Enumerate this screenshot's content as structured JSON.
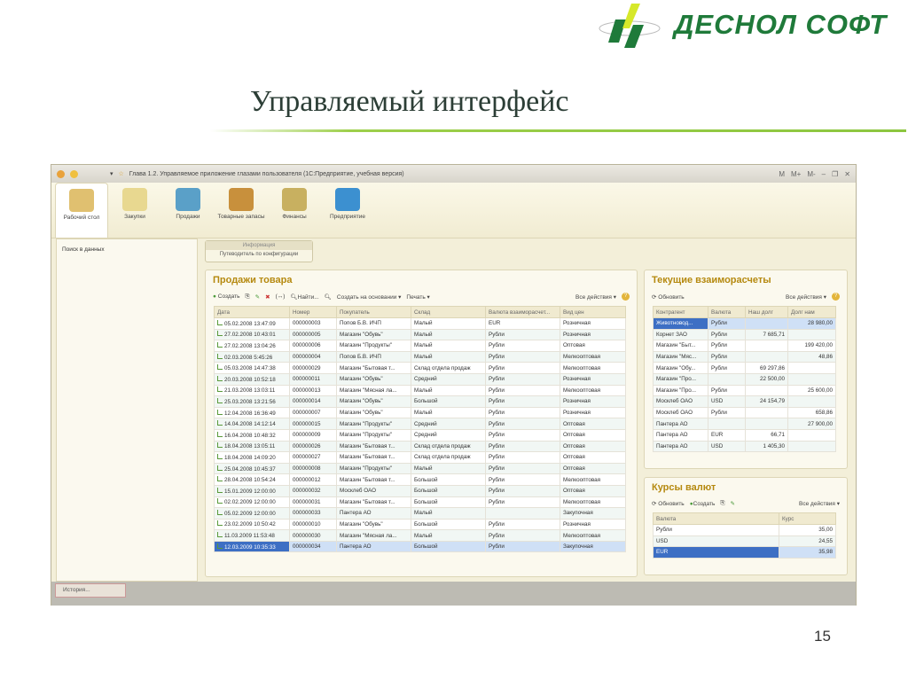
{
  "slide": {
    "logo_text": "ДЕСНОЛ СОФТ",
    "title": "Управляемый интерфейс",
    "page_number": "15"
  },
  "app": {
    "window_title": "Глава 1.2. Управляемое приложение глазами пользователя  (1С:Предприятие, учебная версия)",
    "titlebar_buttons": [
      "M",
      "M+",
      "M-"
    ],
    "sections": [
      "Рабочий стол",
      "Закупки",
      "Продажи",
      "Товарные запасы",
      "Финансы",
      "Предприятие"
    ],
    "left_panel": {
      "search": "Поиск в данных"
    },
    "info": {
      "header": "Информация",
      "link": "Путеводитель по конфигурации"
    },
    "history_tab": "История..."
  },
  "sales": {
    "title": "Продажи товара",
    "toolbar": {
      "create": "Создать",
      "find": "Найти...",
      "create_based": "Создать на основании ▾",
      "print": "Печать ▾",
      "all_actions": "Все действия ▾"
    },
    "columns": [
      "Дата",
      "Номер",
      "Покупатель",
      "Склад",
      "Валюта взаиморасчет...",
      "Вид цен"
    ],
    "rows": [
      [
        "05.02.2008 13:47:09",
        "000000003",
        "Попов Б.В. ИЧП",
        "Малый",
        "EUR",
        "Розничная"
      ],
      [
        "27.02.2008 10:43:01",
        "000000005",
        "Магазин \"Обувь\"",
        "Малый",
        "Рубли",
        "Розничная"
      ],
      [
        "27.02.2008 13:04:26",
        "000000006",
        "Магазин \"Продукты\"",
        "Малый",
        "Рубли",
        "Оптовая"
      ],
      [
        "02.03.2008 5:45:26",
        "000000004",
        "Попов Б.В. ИЧП",
        "Малый",
        "Рубли",
        "Мелкооптовая"
      ],
      [
        "05.03.2008 14:47:38",
        "000000029",
        "Магазин \"Бытовая т...",
        "Склад отдела продаж",
        "Рубли",
        "Мелкооптовая"
      ],
      [
        "20.03.2008 10:52:18",
        "000000011",
        "Магазин \"Обувь\"",
        "Средний",
        "Рубли",
        "Розничная"
      ],
      [
        "21.03.2008 13:03:11",
        "000000013",
        "Магазин \"Мясная ла...",
        "Малый",
        "Рубли",
        "Мелкооптовая"
      ],
      [
        "25.03.2008 13:21:56",
        "000000014",
        "Магазин \"Обувь\"",
        "Большой",
        "Рубли",
        "Розничная"
      ],
      [
        "12.04.2008 16:36:49",
        "000000007",
        "Магазин \"Обувь\"",
        "Малый",
        "Рубли",
        "Розничная"
      ],
      [
        "14.04.2008 14:12:14",
        "000000015",
        "Магазин \"Продукты\"",
        "Средний",
        "Рубли",
        "Оптовая"
      ],
      [
        "16.04.2008 10:48:32",
        "000000009",
        "Магазин \"Продукты\"",
        "Средний",
        "Рубли",
        "Оптовая"
      ],
      [
        "18.04.2008 13:05:11",
        "000000026",
        "Магазин \"Бытовая т...",
        "Склад отдела продаж",
        "Рубли",
        "Оптовая"
      ],
      [
        "18.04.2008 14:09:20",
        "000000027",
        "Магазин \"Бытовая т...",
        "Склад отдела продаж",
        "Рубли",
        "Оптовая"
      ],
      [
        "25.04.2008 10:45:37",
        "000000008",
        "Магазин \"Продукты\"",
        "Малый",
        "Рубли",
        "Оптовая"
      ],
      [
        "28.04.2008 10:54:24",
        "000000012",
        "Магазин \"Бытовая т...",
        "Большой",
        "Рубли",
        "Мелкооптовая"
      ],
      [
        "15.01.2009 12:00:00",
        "000000032",
        "Москлеб ОАО",
        "Большой",
        "Рубли",
        "Оптовая"
      ],
      [
        "02.02.2009 12:00:00",
        "000000031",
        "Магазин \"Бытовая т...",
        "Большой",
        "Рубли",
        "Мелкооптовая"
      ],
      [
        "05.02.2009 12:00:00",
        "000000033",
        "Пантера АО",
        "Малый",
        "",
        "Закупочная"
      ],
      [
        "23.02.2009 10:50:42",
        "000000010",
        "Магазин \"Обувь\"",
        "Большой",
        "Рубли",
        "Розничная"
      ],
      [
        "11.03.2009 11:53:48",
        "000000030",
        "Магазин \"Мясная ла...",
        "Малый",
        "Рубли",
        "Мелкооптовая"
      ],
      [
        "12.03.2009 10:35:33",
        "000000034",
        "Пантера АО",
        "Большой",
        "Рубли",
        "Закупочная"
      ]
    ]
  },
  "settlements": {
    "title": "Текущие взаиморасчеты",
    "refresh": "Обновить",
    "all_actions": "Все действия ▾",
    "columns": [
      "Контрагент",
      "Валюта",
      "Наш долг",
      "Долг нам"
    ],
    "rows": [
      [
        "Животновод...",
        "Рубли",
        "",
        "28 980,00"
      ],
      [
        "Корнет ЗАО",
        "Рубли",
        "7 685,71",
        ""
      ],
      [
        "Магазин \"Быт...",
        "Рубли",
        "",
        "199 420,00"
      ],
      [
        "Магазин \"Мяс...",
        "Рубли",
        "",
        "48,86"
      ],
      [
        "Магазин \"Обу...",
        "Рубли",
        "69 297,86",
        ""
      ],
      [
        "Магазин \"Про...",
        "",
        "22 500,00",
        ""
      ],
      [
        "Магазин \"Про...",
        "Рубли",
        "",
        "25 600,00"
      ],
      [
        "Москлеб ОАО",
        "USD",
        "24 154,79",
        ""
      ],
      [
        "Москлеб ОАО",
        "Рубли",
        "",
        "658,86"
      ],
      [
        "Пантера АО",
        "",
        "",
        "27 900,00"
      ],
      [
        "Пантера АО",
        "EUR",
        "66,71",
        ""
      ],
      [
        "Пантера АО",
        "USD",
        "1 405,30",
        ""
      ]
    ]
  },
  "rates": {
    "title": "Курсы валют",
    "refresh": "Обновить",
    "create": "Создать",
    "all_actions": "Все действия ▾",
    "columns": [
      "Валюта",
      "Курс"
    ],
    "rows": [
      [
        "Рубли",
        "35,00"
      ],
      [
        "USD",
        "24,55"
      ],
      [
        "EUR",
        "35,98"
      ]
    ]
  }
}
